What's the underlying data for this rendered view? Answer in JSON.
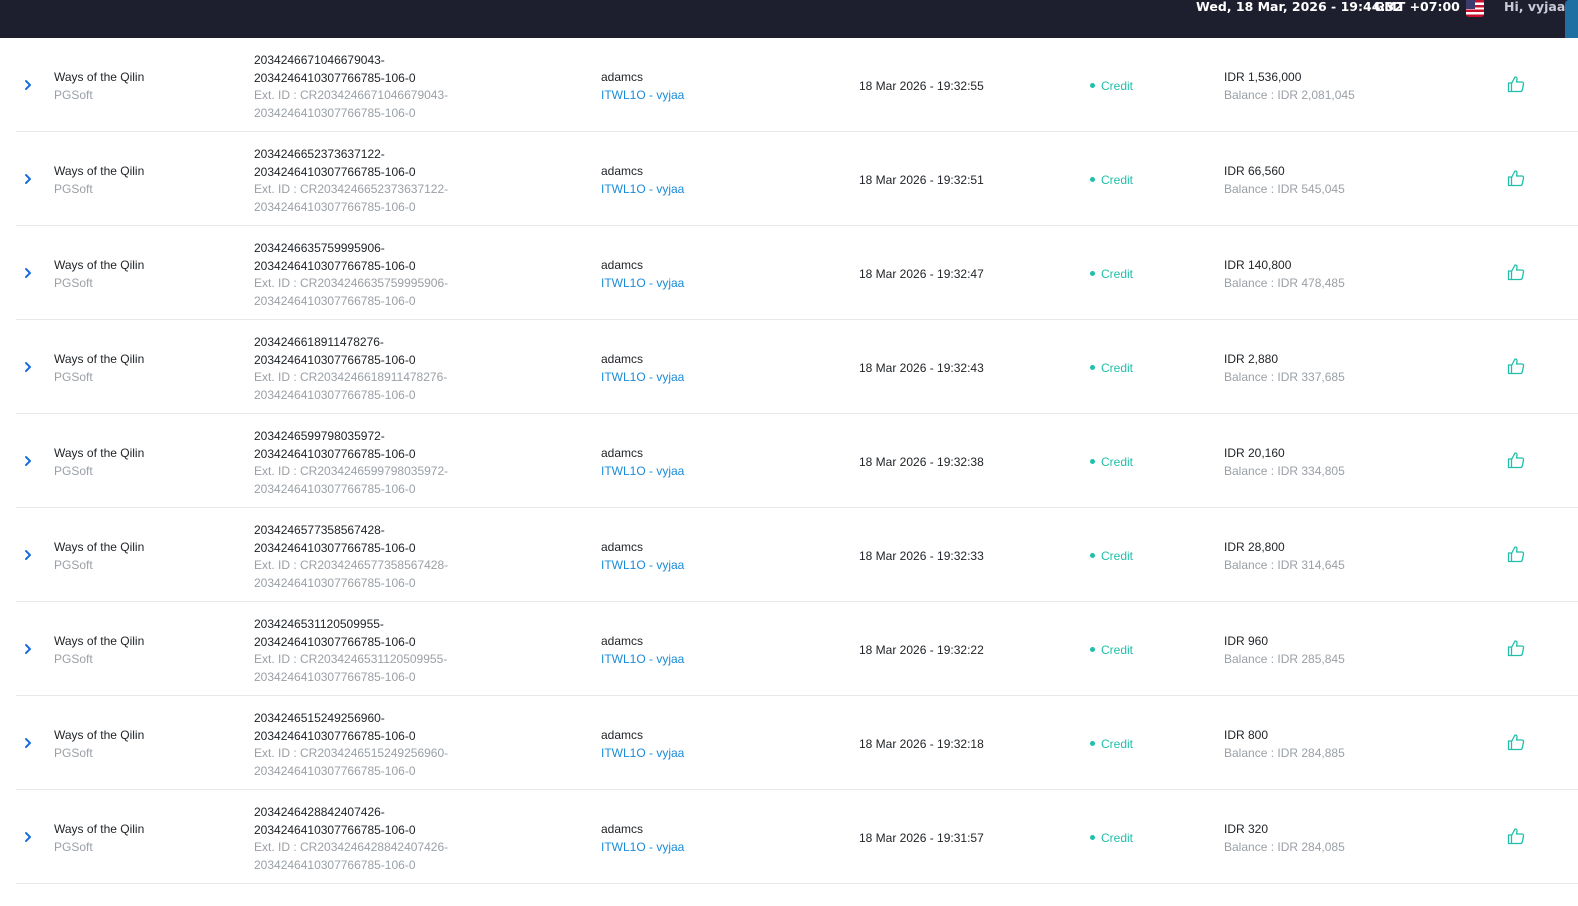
{
  "header": {
    "datetime": "Wed, 18 Mar, 2026 - 19:44:32",
    "timezone": "GMT +07:00",
    "greeting": "Hi, vyjaa",
    "flag_icon": "us-flag-icon"
  },
  "colors": {
    "topbar": "#1e1f2e",
    "credit": "#1fbfa9",
    "link": "#1a8cd8",
    "muted": "#9aa0a6",
    "text": "#212529"
  },
  "transactions": [
    {
      "game": "Ways of the Qilin",
      "provider": "PGSoft",
      "tx_line1": "2034246671046679043-",
      "tx_line2": "2034246410307766785-106-0",
      "ext_line1": "Ext. ID : CR2034246671046679043-",
      "ext_line2": "2034246410307766785-106-0",
      "user": "adamcs",
      "agent": "ITWL1O - vyjaa",
      "time": "18 Mar 2026 - 19:32:55",
      "type": "Credit",
      "amount": "IDR 1,536,000",
      "balance": "Balance : IDR 2,081,045"
    },
    {
      "game": "Ways of the Qilin",
      "provider": "PGSoft",
      "tx_line1": "2034246652373637122-",
      "tx_line2": "2034246410307766785-106-0",
      "ext_line1": "Ext. ID : CR2034246652373637122-",
      "ext_line2": "2034246410307766785-106-0",
      "user": "adamcs",
      "agent": "ITWL1O - vyjaa",
      "time": "18 Mar 2026 - 19:32:51",
      "type": "Credit",
      "amount": "IDR 66,560",
      "balance": "Balance : IDR 545,045"
    },
    {
      "game": "Ways of the Qilin",
      "provider": "PGSoft",
      "tx_line1": "2034246635759995906-",
      "tx_line2": "2034246410307766785-106-0",
      "ext_line1": "Ext. ID : CR2034246635759995906-",
      "ext_line2": "2034246410307766785-106-0",
      "user": "adamcs",
      "agent": "ITWL1O - vyjaa",
      "time": "18 Mar 2026 - 19:32:47",
      "type": "Credit",
      "amount": "IDR 140,800",
      "balance": "Balance : IDR 478,485"
    },
    {
      "game": "Ways of the Qilin",
      "provider": "PGSoft",
      "tx_line1": "2034246618911478276-",
      "tx_line2": "2034246410307766785-106-0",
      "ext_line1": "Ext. ID : CR2034246618911478276-",
      "ext_line2": "2034246410307766785-106-0",
      "user": "adamcs",
      "agent": "ITWL1O - vyjaa",
      "time": "18 Mar 2026 - 19:32:43",
      "type": "Credit",
      "amount": "IDR 2,880",
      "balance": "Balance : IDR 337,685"
    },
    {
      "game": "Ways of the Qilin",
      "provider": "PGSoft",
      "tx_line1": "2034246599798035972-",
      "tx_line2": "2034246410307766785-106-0",
      "ext_line1": "Ext. ID : CR2034246599798035972-",
      "ext_line2": "2034246410307766785-106-0",
      "user": "adamcs",
      "agent": "ITWL1O - vyjaa",
      "time": "18 Mar 2026 - 19:32:38",
      "type": "Credit",
      "amount": "IDR 20,160",
      "balance": "Balance : IDR 334,805"
    },
    {
      "game": "Ways of the Qilin",
      "provider": "PGSoft",
      "tx_line1": "2034246577358567428-",
      "tx_line2": "2034246410307766785-106-0",
      "ext_line1": "Ext. ID : CR2034246577358567428-",
      "ext_line2": "2034246410307766785-106-0",
      "user": "adamcs",
      "agent": "ITWL1O - vyjaa",
      "time": "18 Mar 2026 - 19:32:33",
      "type": "Credit",
      "amount": "IDR 28,800",
      "balance": "Balance : IDR 314,645"
    },
    {
      "game": "Ways of the Qilin",
      "provider": "PGSoft",
      "tx_line1": "2034246531120509955-",
      "tx_line2": "2034246410307766785-106-0",
      "ext_line1": "Ext. ID : CR2034246531120509955-",
      "ext_line2": "2034246410307766785-106-0",
      "user": "adamcs",
      "agent": "ITWL1O - vyjaa",
      "time": "18 Mar 2026 - 19:32:22",
      "type": "Credit",
      "amount": "IDR 960",
      "balance": "Balance : IDR 285,845"
    },
    {
      "game": "Ways of the Qilin",
      "provider": "PGSoft",
      "tx_line1": "2034246515249256960-",
      "tx_line2": "2034246410307766785-106-0",
      "ext_line1": "Ext. ID : CR2034246515249256960-",
      "ext_line2": "2034246410307766785-106-0",
      "user": "adamcs",
      "agent": "ITWL1O - vyjaa",
      "time": "18 Mar 2026 - 19:32:18",
      "type": "Credit",
      "amount": "IDR 800",
      "balance": "Balance : IDR 284,885"
    },
    {
      "game": "Ways of the Qilin",
      "provider": "PGSoft",
      "tx_line1": "2034246428842407426-",
      "tx_line2": "2034246410307766785-106-0",
      "ext_line1": "Ext. ID : CR2034246428842407426-",
      "ext_line2": "2034246410307766785-106-0",
      "user": "adamcs",
      "agent": "ITWL1O - vyjaa",
      "time": "18 Mar 2026 - 19:31:57",
      "type": "Credit",
      "amount": "IDR 320",
      "balance": "Balance : IDR 284,085"
    }
  ]
}
